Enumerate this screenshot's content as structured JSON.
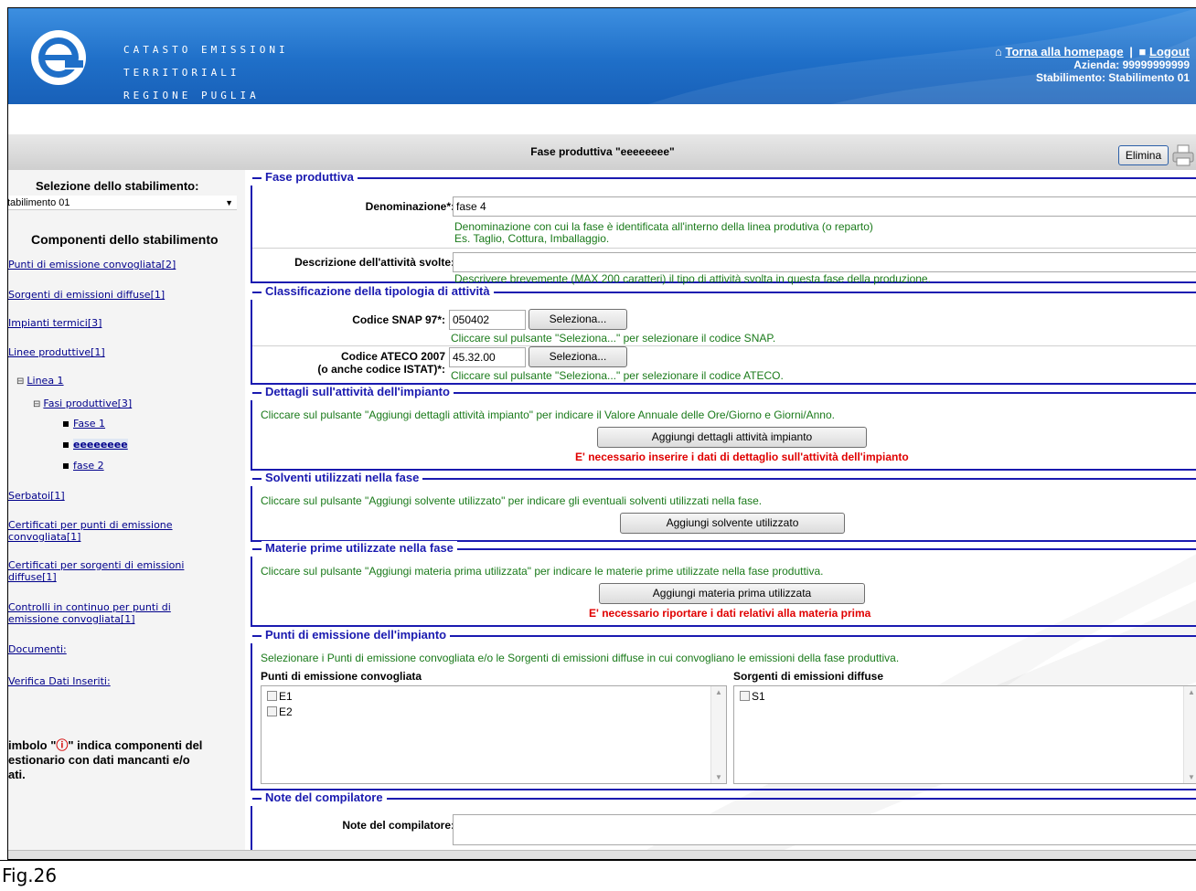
{
  "header": {
    "brand_lines": [
      "Catasto Emissioni",
      "Territoriali",
      "Regione Puglia"
    ],
    "home_link": "Torna alla homepage",
    "logout_link": "Logout",
    "azienda": "Azienda: 99999999999",
    "stabilimento": "Stabilimento: Stabilimento 01"
  },
  "titlebar": {
    "title": "Fase produttiva \"eeeeeeee\"",
    "delete_label": "Elimina"
  },
  "sidebar": {
    "selection_title": "Selezione dello stabilimento:",
    "selected_value": "tabilimento 01",
    "components_title": "Componenti dello stabilimento",
    "links": {
      "punti": "Punti di emissione convogliata[2]",
      "sorgenti": "Sorgenti di emissioni diffuse[1]",
      "impianti": "Impianti termici[3]",
      "linee": "Linee produttive[1]",
      "linea1": "Linea 1",
      "fasi": "Fasi produttive[3]",
      "fase1": "Fase 1",
      "current": "eeeeeeee",
      "fase2": "fase 2",
      "serbatoi": "Serbatoi[1]",
      "cert_punti": "Certificati per punti di emissione convogliata[1]",
      "cert_sorgenti": "Certificati per sorgenti di emissioni diffuse[1]",
      "controlli": "Controlli in continuo per punti di emissione convogliata[1]",
      "documenti": "Documenti:",
      "verifica": "Verifica Dati Inseriti:"
    },
    "legend_line1_pre": "imbolo \"",
    "legend_line1_post": "\" indica componenti del",
    "legend_line2": "estionario con dati mancanti e/o",
    "legend_line3": "ati."
  },
  "sections": {
    "fase": {
      "legend": "Fase produttiva",
      "denominazione_label": "Denominazione*:",
      "denominazione_value": "fase 4",
      "denominazione_hint1": "Denominazione con cui la fase è identificata all'interno della linea produtiva (o reparto)",
      "denominazione_hint2": "Es. Taglio, Cottura, Imballaggio.",
      "descrizione_label": "Descrizione dell'attività svolte:",
      "descrizione_value": "",
      "descrizione_hint": "Descrivere brevemente (MAX 200 caratteri) il tipo di attività svolta in questa fase della produzione."
    },
    "classificazione": {
      "legend": "Classificazione della tipologia di attività",
      "snap_label": "Codice SNAP 97*:",
      "snap_value": "050402",
      "select_label": "Seleziona...",
      "snap_hint": "Cliccare sul pulsante \"Seleziona...\" per selezionare il codice SNAP.",
      "ateco_label1": "Codice ATECO 2007",
      "ateco_label2": "(o anche codice ISTAT)*:",
      "ateco_value": "45.32.00",
      "ateco_hint": "Cliccare sul pulsante \"Seleziona...\" per selezionare il codice ATECO."
    },
    "dettagli": {
      "legend": "Dettagli sull'attività dell'impianto",
      "hint": "Cliccare sul pulsante \"Aggiungi dettagli attività impianto\" per indicare il Valore Annuale delle Ore/Giorno e Giorni/Anno.",
      "button": "Aggiungi dettagli attività impianto",
      "error": "E' necessario inserire i dati di dettaglio sull'attività dell'impianto"
    },
    "solventi": {
      "legend": "Solventi utilizzati nella fase",
      "hint": "Cliccare sul pulsante \"Aggiungi solvente utilizzato\" per indicare gli eventuali solventi utilizzati nella fase.",
      "button": "Aggiungi solvente utilizzato"
    },
    "materie": {
      "legend": "Materie prime utilizzate nella fase",
      "hint": "Cliccare sul pulsante \"Aggiungi materia prima utilizzata\" per indicare le materie prime utilizzate nella fase produttiva.",
      "button": "Aggiungi materia prima utilizzata",
      "error": "E' necessario riportare i dati relativi alla materia prima"
    },
    "punti": {
      "legend": "Punti di emissione dell'impianto",
      "hint": "Selezionare i Punti di emissione convogliata e/o le Sorgenti di emissioni diffuse in cui convogliano le emissioni della fase produttiva.",
      "col1": "Punti di emissione convogliata",
      "col2": "Sorgenti di emissioni diffuse",
      "items1": [
        "E1",
        "E2"
      ],
      "items2": [
        "S1"
      ]
    },
    "note": {
      "legend": "Note del compilatore",
      "label": "Note del compilatore:"
    }
  },
  "caption": "Fig.26",
  "colors": {
    "header_blue": "#1f6fc8",
    "fieldset_blue": "#1a1ab0",
    "hint_green": "#1a7a1a",
    "error_red": "#e00000"
  }
}
